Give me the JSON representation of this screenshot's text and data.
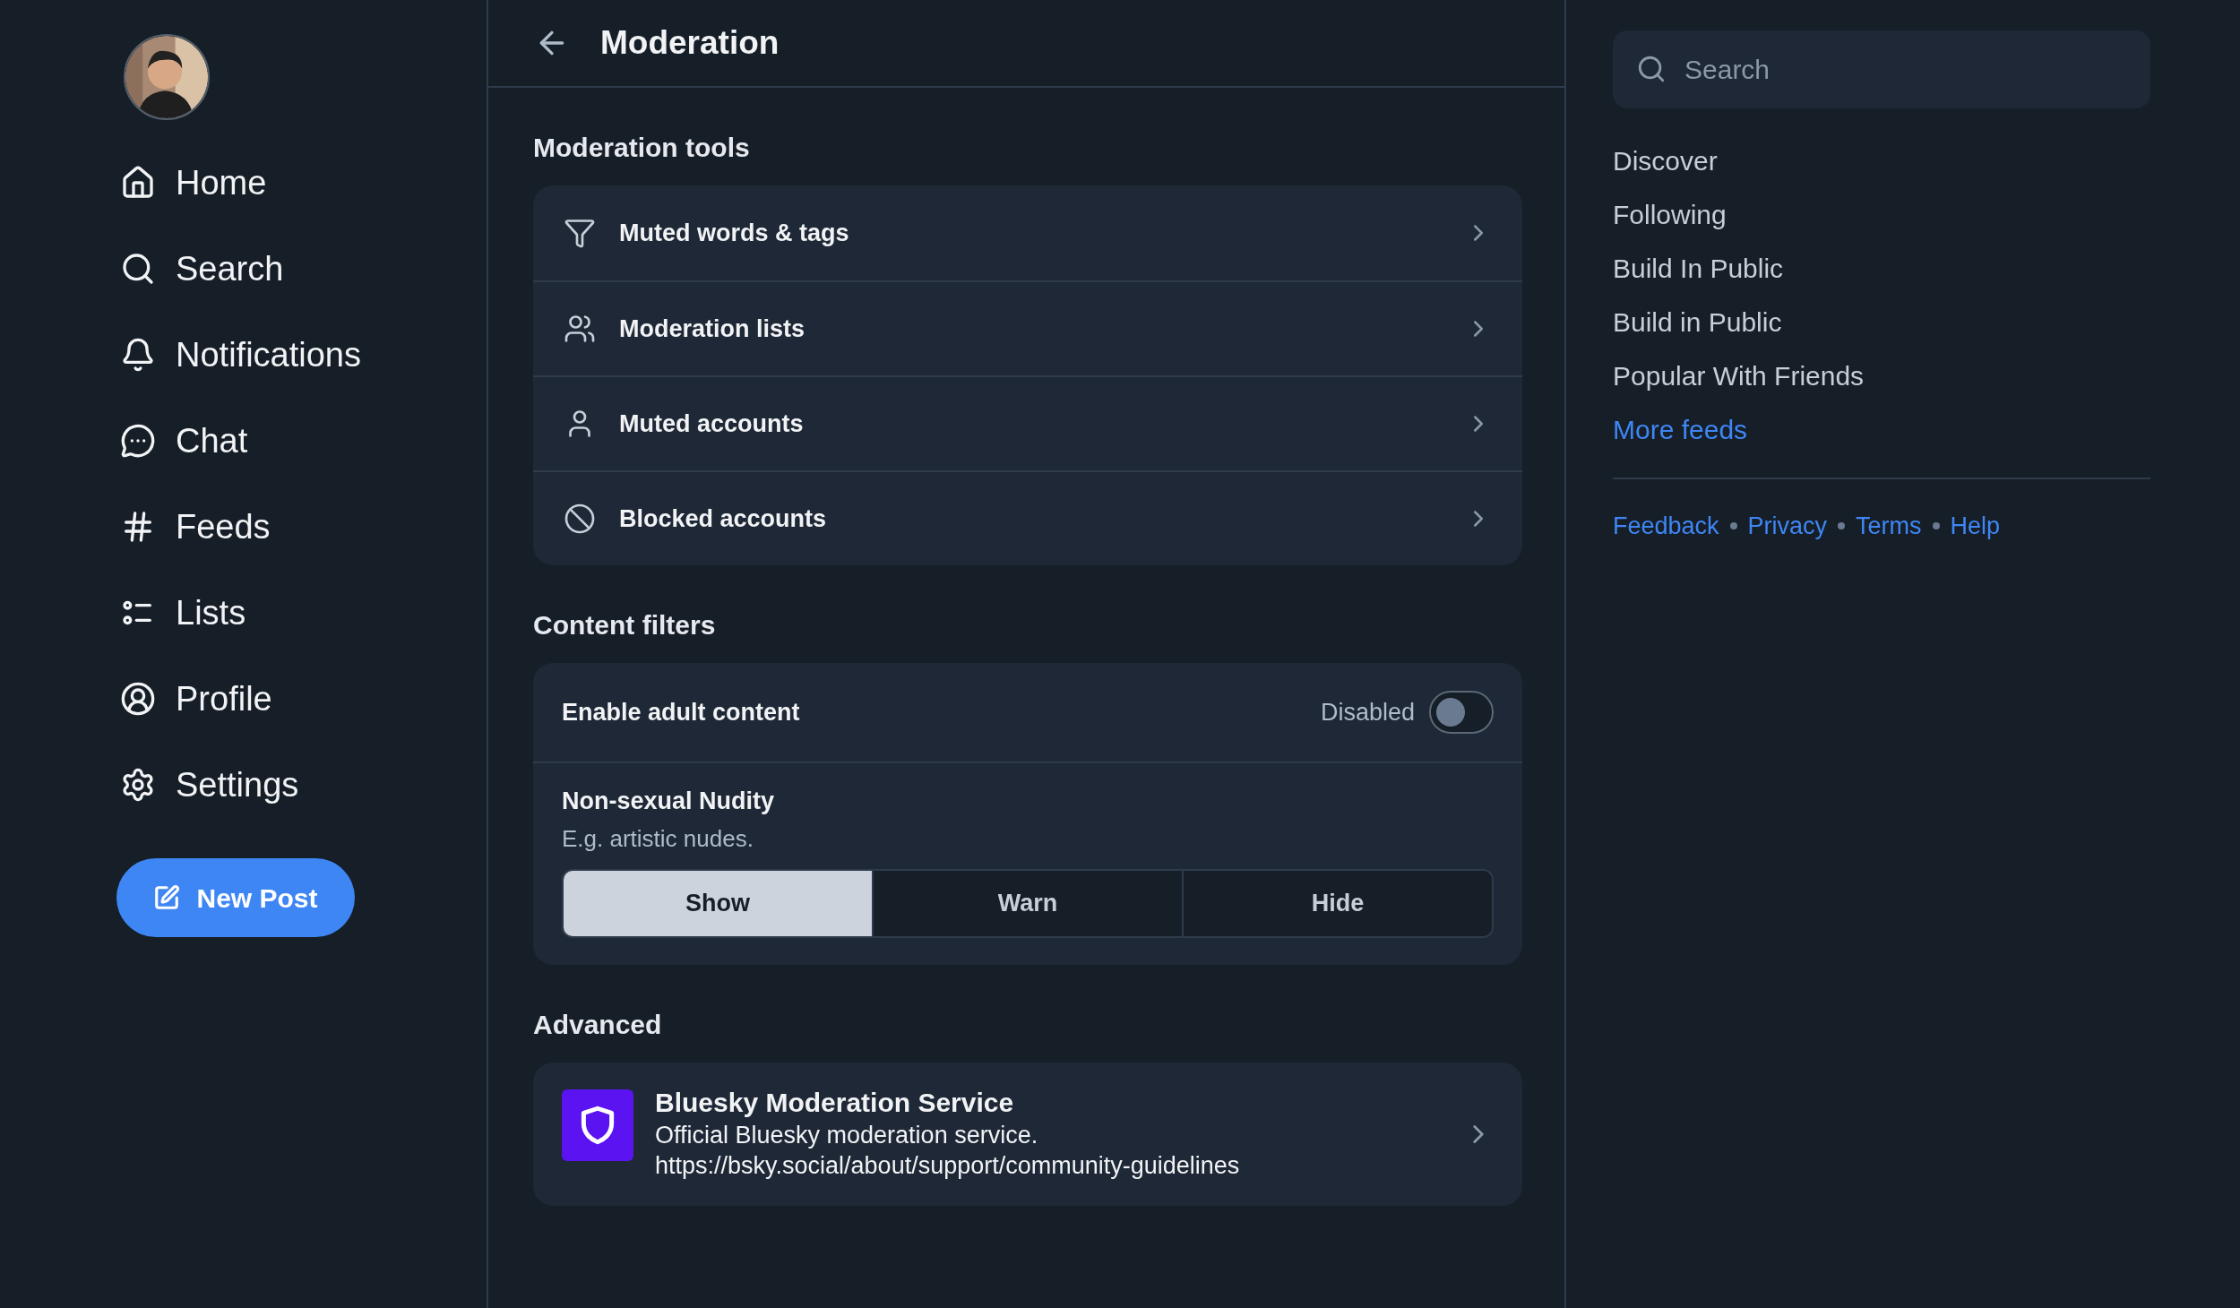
{
  "sidebar": {
    "nav": [
      {
        "kind": "home",
        "label": "Home"
      },
      {
        "kind": "search",
        "label": "Search"
      },
      {
        "kind": "notifications",
        "label": "Notifications"
      },
      {
        "kind": "chat",
        "label": "Chat"
      },
      {
        "kind": "feeds",
        "label": "Feeds"
      },
      {
        "kind": "lists",
        "label": "Lists"
      },
      {
        "kind": "profile",
        "label": "Profile"
      },
      {
        "kind": "settings",
        "label": "Settings"
      }
    ],
    "new_post_button": "New Post"
  },
  "header": {
    "title": "Moderation"
  },
  "moderation_tools": {
    "heading": "Moderation tools",
    "items": [
      {
        "kind": "muted_words",
        "label": "Muted words & tags"
      },
      {
        "kind": "lists",
        "label": "Moderation lists"
      },
      {
        "kind": "muted_accounts",
        "label": "Muted accounts"
      },
      {
        "kind": "blocked",
        "label": "Blocked accounts"
      }
    ]
  },
  "content_filters": {
    "heading": "Content filters",
    "adult_content": {
      "label": "Enable adult content",
      "status": "Disabled",
      "on": false
    },
    "filters": [
      {
        "title": "Non-sexual Nudity",
        "description": "E.g. artistic nudes.",
        "options": [
          {
            "label": "Show",
            "selected": true
          },
          {
            "label": "Warn",
            "selected": false
          },
          {
            "label": "Hide",
            "selected": false
          }
        ]
      }
    ]
  },
  "advanced": {
    "heading": "Advanced",
    "services": [
      {
        "name": "Bluesky Moderation Service",
        "description": "Official Bluesky moderation service.",
        "url": "https://bsky.social/about/support/community-guidelines"
      }
    ]
  },
  "right_panel": {
    "search": {
      "placeholder": "Search"
    },
    "feeds": [
      "Discover",
      "Following",
      "Build In Public",
      "Build in Public",
      "Popular With Friends"
    ],
    "more_feeds_link": "More feeds",
    "footer_links": [
      "Feedback",
      "Privacy",
      "Terms",
      "Help"
    ]
  }
}
